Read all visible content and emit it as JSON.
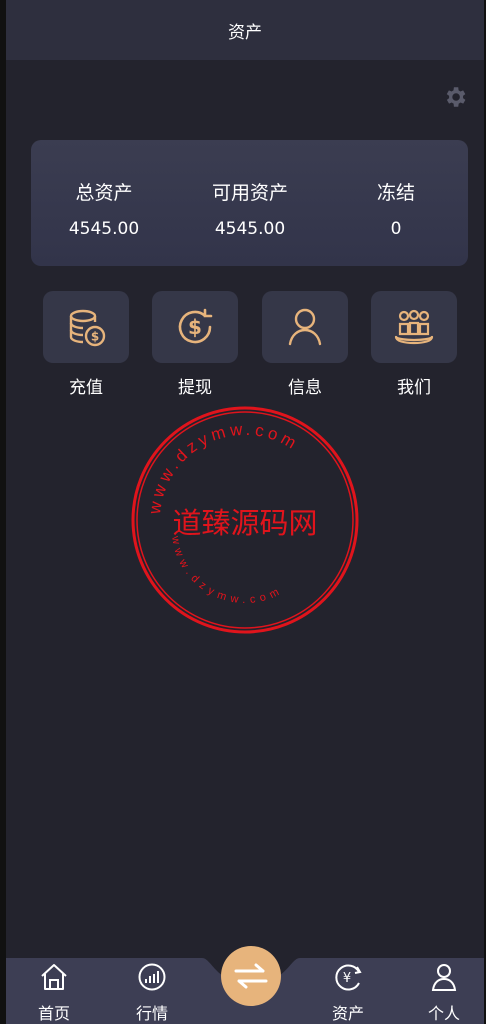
{
  "header": {
    "title": "资产"
  },
  "assets": [
    {
      "label": "总资产",
      "value": "4545.00"
    },
    {
      "label": "可用资产",
      "value": "4545.00"
    },
    {
      "label": "冻结",
      "value": "0"
    }
  ],
  "actions": [
    {
      "label": "充值",
      "icon": "coins-deposit-icon"
    },
    {
      "label": "提现",
      "icon": "dollar-withdraw-icon"
    },
    {
      "label": "信息",
      "icon": "user-icon"
    },
    {
      "label": "我们",
      "icon": "team-icon"
    }
  ],
  "watermark": {
    "center_text": "道臻源码网",
    "ring_text": "www.dzymw.com",
    "color": "#e0141c"
  },
  "tabbar": {
    "items": [
      {
        "label": "首页",
        "icon": "home-icon"
      },
      {
        "label": "行情",
        "icon": "chart-icon"
      },
      {
        "label": "资产",
        "icon": "yen-cycle-icon"
      },
      {
        "label": "个人",
        "icon": "person-icon"
      }
    ],
    "center_icon": "swap-arrows-icon"
  },
  "colors": {
    "background": "#23232d",
    "card": "#3b3d51",
    "accent": "#e7b47c",
    "header": "#2e2f3e"
  }
}
